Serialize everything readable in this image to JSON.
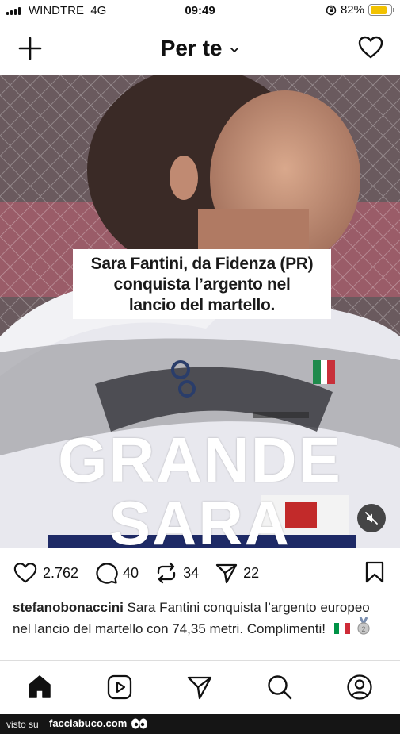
{
  "status_bar": {
    "carrier": "WINDTRE",
    "network": "4G",
    "time": "09:49",
    "battery": "82%",
    "battery_level": 0.82
  },
  "header": {
    "title": "Per te",
    "add_icon": "plus-icon",
    "feed_dropdown_icon": "chevron-down-icon",
    "activity_icon": "heart-icon"
  },
  "media": {
    "caption": [
      "Sara Fantini, da Fidenza (PR)",
      "conquista l’argento nel",
      "lancio del martello."
    ],
    "overlay_line1": "GRANDE",
    "overlay_line2": "SARA",
    "mute_icon": "speaker-muted-icon"
  },
  "actions": {
    "likes": "2.762",
    "comments": "40",
    "reposts": "34",
    "shares": "22"
  },
  "post": {
    "username": "stefanobonaccini",
    "text": "Sara Fantini conquista l’argento europeo nel lancio del martello con 74,35 metri. Complimenti!",
    "flag_colors": [
      "#009246",
      "#ffffff",
      "#ce2b37"
    ]
  },
  "tabbar": {
    "items": [
      "home-icon",
      "reels-icon",
      "messages-icon",
      "search-icon",
      "profile-icon"
    ]
  },
  "watermark": {
    "prefix": "visto su",
    "site": "facciabuco.com"
  }
}
